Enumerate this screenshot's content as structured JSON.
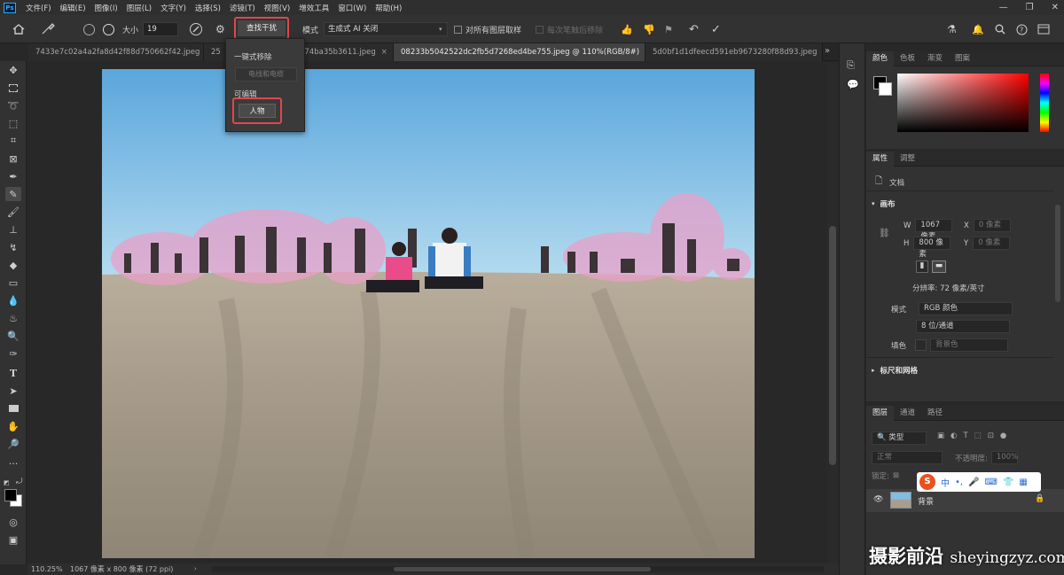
{
  "app": {
    "logo": "Ps"
  },
  "menu": [
    "文件(F)",
    "编辑(E)",
    "图像(I)",
    "图层(L)",
    "文字(Y)",
    "选择(S)",
    "滤镜(T)",
    "视图(V)",
    "增效工具",
    "窗口(W)",
    "帮助(H)"
  ],
  "options": {
    "size_label": "大小",
    "size_value": "19",
    "find_button": "查找干扰",
    "mode_label": "模式",
    "mode_value": "生成式 AI 关闭",
    "sample_all": "对所有图层取样",
    "remove_each": "每次笔触后移除"
  },
  "dropdown": {
    "one_click": "一键式移除",
    "wires": "电线和电缆",
    "section2": "可编辑",
    "people": "人物"
  },
  "tabs": [
    {
      "label": "7433e7c02a4a2fa8d42f88d750662f42.jpeg",
      "active": false
    },
    {
      "label": "25",
      "active": false
    },
    {
      "label": "d74ba35b3611.jpeg",
      "active": false
    },
    {
      "label": "08233b5042522dc2fb5d7268ed4be755.jpeg @ 110%(RGB/8#)",
      "active": true
    },
    {
      "label": "5d0bf1d1dfeecd591eb9673280f88d93.jpeg",
      "active": false
    }
  ],
  "status": {
    "zoom": "110.25%",
    "doc": "1067 像素 x 800 像素 (72 ppi)"
  },
  "color_panel": {
    "tabs": [
      "颜色",
      "色板",
      "渐变",
      "图案"
    ]
  },
  "props_panel": {
    "tabs": [
      "属性",
      "调整"
    ],
    "doc_label": "文档",
    "canvas_title": "画布",
    "w_label": "W",
    "w_value": "1067 像素",
    "h_label": "H",
    "h_value": "800 像素",
    "x_label": "X",
    "x_value": "0 像素",
    "y_label": "Y",
    "y_value": "0 像素",
    "resolution": "分辨率: 72 像素/英寸",
    "mode_label": "模式",
    "mode_value": "RGB 颜色",
    "depth_value": "8 位/通道",
    "fill_label": "填色",
    "fill_value": "背景色",
    "rulers_title": "标尺和网格"
  },
  "layers_panel": {
    "tabs": [
      "图层",
      "通道",
      "路径"
    ],
    "kind_label": "类型",
    "blend": "正常",
    "opacity_label": "不透明度:",
    "opacity_value": "100%",
    "lock_label": "锁定:",
    "layer_name": "背景"
  },
  "ime": {
    "badge": "S",
    "mode": "中"
  },
  "watermark": {
    "cn": "摄影前沿",
    "en": "sheyingzyz.com"
  },
  "colors": {
    "accent_red": "#e0474c",
    "ps_blue": "#31a8ff",
    "sky": "#8fc8ea",
    "sand": "#a79d8e"
  }
}
